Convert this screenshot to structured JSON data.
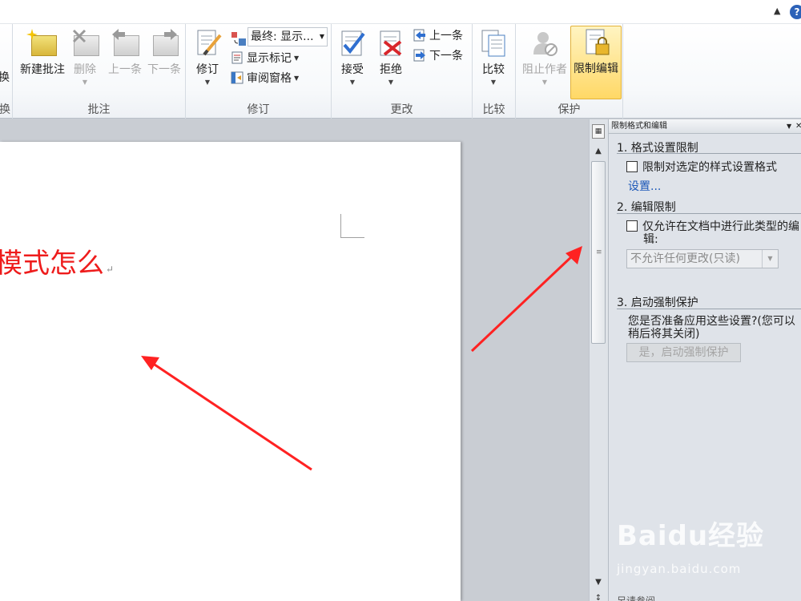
{
  "titlebar": {
    "caret_icon": "chevron-up-icon",
    "help_label": "?"
  },
  "ribbon": {
    "partial_group": {
      "button_label": "换",
      "group_label": "换"
    },
    "comments": {
      "group_label": "批注",
      "new_comment": "新建批注",
      "delete": "删除",
      "previous": "上一条",
      "next": "下一条"
    },
    "tracking": {
      "group_label": "修订",
      "track_changes": "修订",
      "display_select_value": "最终: 显示...",
      "show_markup": "显示标记",
      "reviewing_pane": "审阅窗格"
    },
    "changes": {
      "group_label": "更改",
      "accept": "接受",
      "reject": "拒绝",
      "previous": "上一条",
      "next": "下一条"
    },
    "compare": {
      "group_label": "比较",
      "compare": "比较"
    },
    "protect": {
      "group_label": "保护",
      "block_authors": "阻止作者",
      "restrict_editing": "限制编辑"
    }
  },
  "document": {
    "visible_text": "模式怎么"
  },
  "taskpane": {
    "title": "限制格式和编辑",
    "section1": {
      "heading": "1.  格式设置限制",
      "checkbox_label": "限制对选定的样式设置格式",
      "link": "设置..."
    },
    "section2": {
      "heading": "2.  编辑限制",
      "checkbox_label_line1": "仅允许在文档中进行此类型的编",
      "checkbox_label_line2": "辑:",
      "select_value": "不允许任何更改(只读)"
    },
    "section3": {
      "heading": "3.  启动强制保护",
      "description_line1": "您是否准备应用这些设置?(您可以",
      "description_line2": "稍后将其关闭)",
      "button_label": "是，启动强制保护"
    },
    "bottom_text": "另请参阅"
  },
  "watermark": {
    "logo_text": "Baidu经验",
    "url": "jingyan.baidu.com"
  },
  "colors": {
    "doc_text": "#ee1c1c",
    "arrow": "#ff2222",
    "active_button": "#ffd866",
    "link": "#1b57b8"
  }
}
